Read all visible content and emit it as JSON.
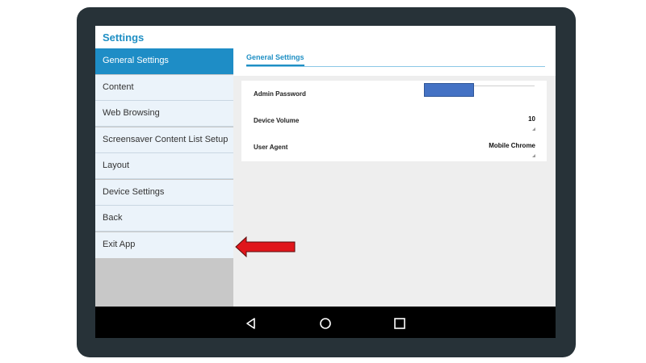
{
  "header": {
    "title": "Settings"
  },
  "sidebar": {
    "items": [
      {
        "label": "General Settings",
        "active": true
      },
      {
        "label": "Content"
      },
      {
        "label": "Web Browsing"
      },
      {
        "label": "Screensaver Content List Setup"
      },
      {
        "label": "Layout"
      },
      {
        "label": "Device Settings"
      },
      {
        "label": "Back"
      },
      {
        "label": "Exit App"
      }
    ]
  },
  "main": {
    "tab_label": "General Settings",
    "rows": [
      {
        "label": "Admin Password",
        "value": ""
      },
      {
        "label": "Device Volume",
        "value": "10"
      },
      {
        "label": "User Agent",
        "value": "Mobile Chrome"
      }
    ]
  },
  "navbar": {
    "icons": [
      "back-triangle-icon",
      "home-circle-icon",
      "recents-square-icon"
    ]
  },
  "colors": {
    "accent": "#1e8dc6",
    "annotation_arrow": "#e0161b",
    "password_fill": "#4472c4"
  }
}
